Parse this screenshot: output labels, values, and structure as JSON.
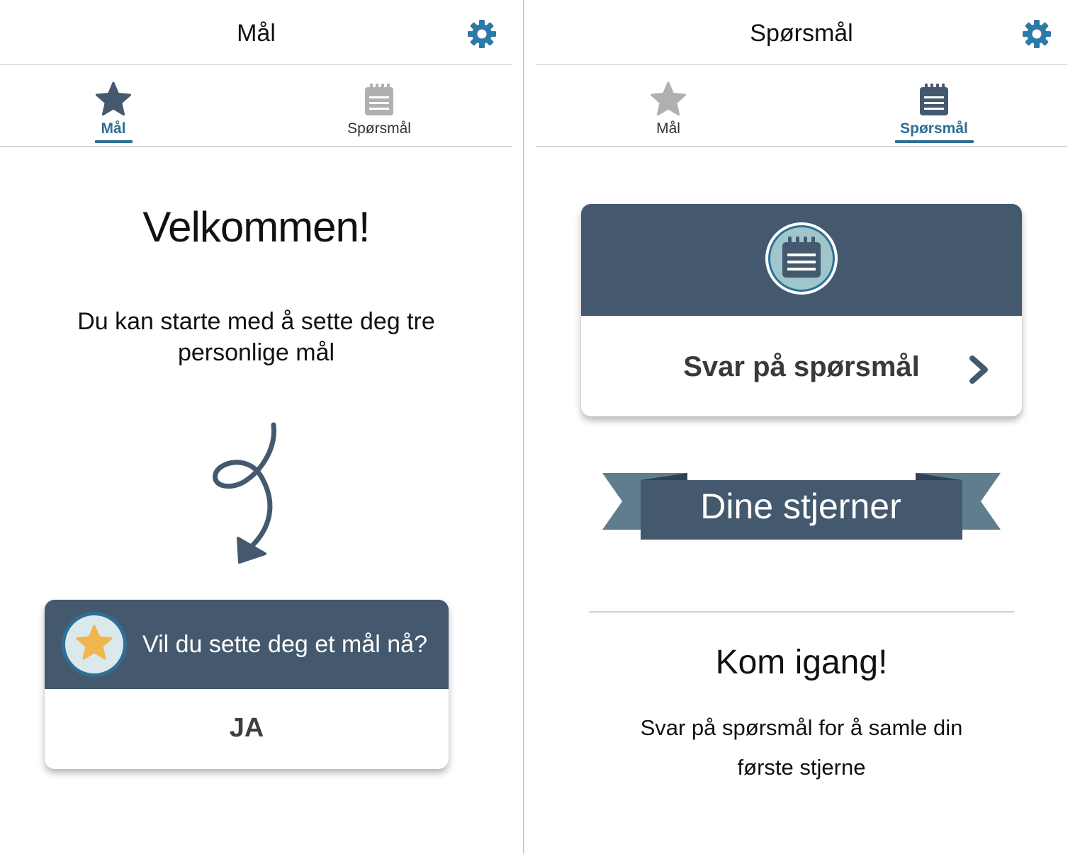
{
  "colors": {
    "brand_dark": "#45596e",
    "accent_blue": "#2e6f95",
    "gear_blue": "#2e7aa6",
    "inactive_gray": "#b0b0b0",
    "star_gold": "#f0b54c",
    "badge_light": "#dce9ec",
    "ribbon_light": "#5f7d8c"
  },
  "left_screen": {
    "header": {
      "title": "Mål",
      "settings_icon": "gear-icon"
    },
    "tabs": [
      {
        "label": "Mål",
        "icon": "star-icon",
        "active": true
      },
      {
        "label": "Spørsmål",
        "icon": "notepad-icon",
        "active": false
      }
    ],
    "welcome": "Velkommen!",
    "intro_line1": "Du kan starte med å sette deg tre",
    "intro_line2": "personlige mål",
    "goal_card": {
      "question": "Vil du sette deg et mål nå?",
      "button": "JA",
      "icon": "star-icon"
    }
  },
  "right_screen": {
    "header": {
      "title": "Spørsmål",
      "settings_icon": "gear-icon"
    },
    "tabs": [
      {
        "label": "Mål",
        "icon": "star-icon",
        "active": false
      },
      {
        "label": "Spørsmål",
        "icon": "notepad-icon",
        "active": true
      }
    ],
    "question_card": {
      "cta": "Svar på spørsmål",
      "icon": "notepad-icon",
      "chevron": "chevron-right-icon"
    },
    "ribbon_title": "Dine stjerner",
    "start": {
      "title": "Kom igang!",
      "text_line1": "Svar på spørsmål for å samle din",
      "text_line2": "første stjerne"
    }
  }
}
